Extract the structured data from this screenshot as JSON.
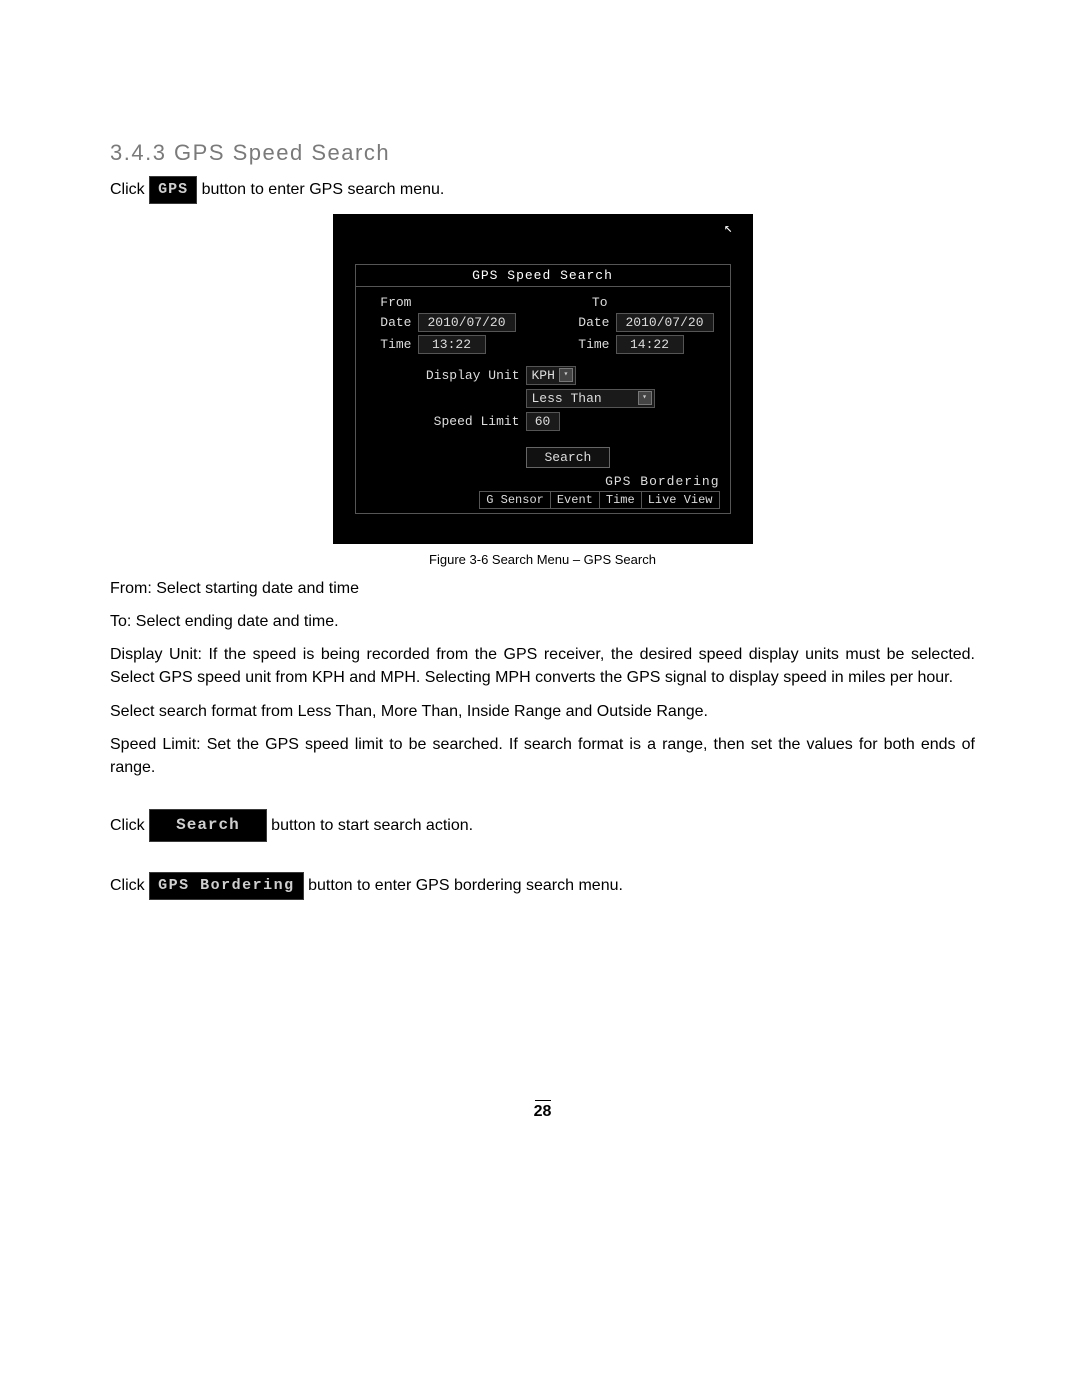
{
  "heading": "3.4.3  GPS Speed Search",
  "intro": {
    "pre": "Click ",
    "btn": "GPS",
    "post": " button to enter GPS search menu."
  },
  "screenshot": {
    "title": "GPS Speed Search",
    "from_lbl": "From",
    "to_lbl": "To",
    "date_lbl": "Date",
    "time_lbl": "Time",
    "from_date": "2010/07/20",
    "to_date": "2010/07/20",
    "from_time": "13:22",
    "to_time": "14:22",
    "display_unit_lbl": "Display Unit",
    "display_unit_val": "KPH",
    "cond_val": "Less Than",
    "speed_limit_lbl": "Speed Limit",
    "speed_limit_val": "60",
    "search_btn": "Search",
    "bordering": "GPS Bordering",
    "tabs": [
      "G Sensor",
      "Event",
      "Time",
      "Live View"
    ]
  },
  "figure_caption": "Figure 3-6 Search Menu – GPS Search",
  "defs": {
    "from": {
      "label": "From: ",
      "text": "Select starting date and time"
    },
    "to": {
      "label": "To: ",
      "text": "Select ending date and time."
    },
    "display_unit": {
      "label": "Display Unit: ",
      "text": "If the speed is being recorded from the GPS receiver, the desired speed display units must be selected. Select GPS speed unit from KPH and MPH. Selecting MPH converts the GPS signal to display speed in miles per hour."
    },
    "format": "Select search format from Less Than, More Than, Inside Range and Outside Range.",
    "speed_limit": {
      "label": "Speed Limit: ",
      "text": "Set the GPS speed limit to be searched. If search format is a range, then set the values for both ends of range."
    }
  },
  "click_search": {
    "pre": "Click ",
    "btn": "Search",
    "post": " button to start search action."
  },
  "click_bordering": {
    "pre": "Click ",
    "btn": "GPS Bordering",
    "post": " button to enter GPS bordering search menu."
  },
  "page_number": "28"
}
